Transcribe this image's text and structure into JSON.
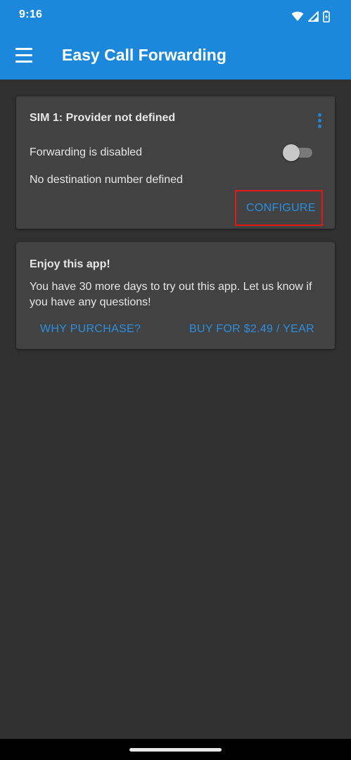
{
  "status_bar": {
    "time": "9:16",
    "icons": [
      "wifi-icon",
      "cell-signal-icon",
      "battery-charging-icon"
    ]
  },
  "app_bar": {
    "title": "Easy Call Forwarding",
    "menu_icon": "hamburger-menu-icon"
  },
  "sim_card": {
    "title": "SIM 1: Provider not defined",
    "status_text": "Forwarding is disabled",
    "forwarding_enabled": false,
    "destination_text": "No destination number defined",
    "configure_label": "CONFIGURE",
    "more_icon": "more-vert-icon"
  },
  "trial_card": {
    "title": "Enjoy this app!",
    "message": "You have 30 more days to try out this app. Let us know if you have any questions!",
    "why_purchase_label": "WHY PURCHASE?",
    "buy_label": "BUY FOR $2.49 / YEAR"
  },
  "colors": {
    "primary": "#1b88dc",
    "accent_text": "#2a8fe0",
    "background": "#303030",
    "card": "#424242",
    "highlight": "#e01818"
  }
}
